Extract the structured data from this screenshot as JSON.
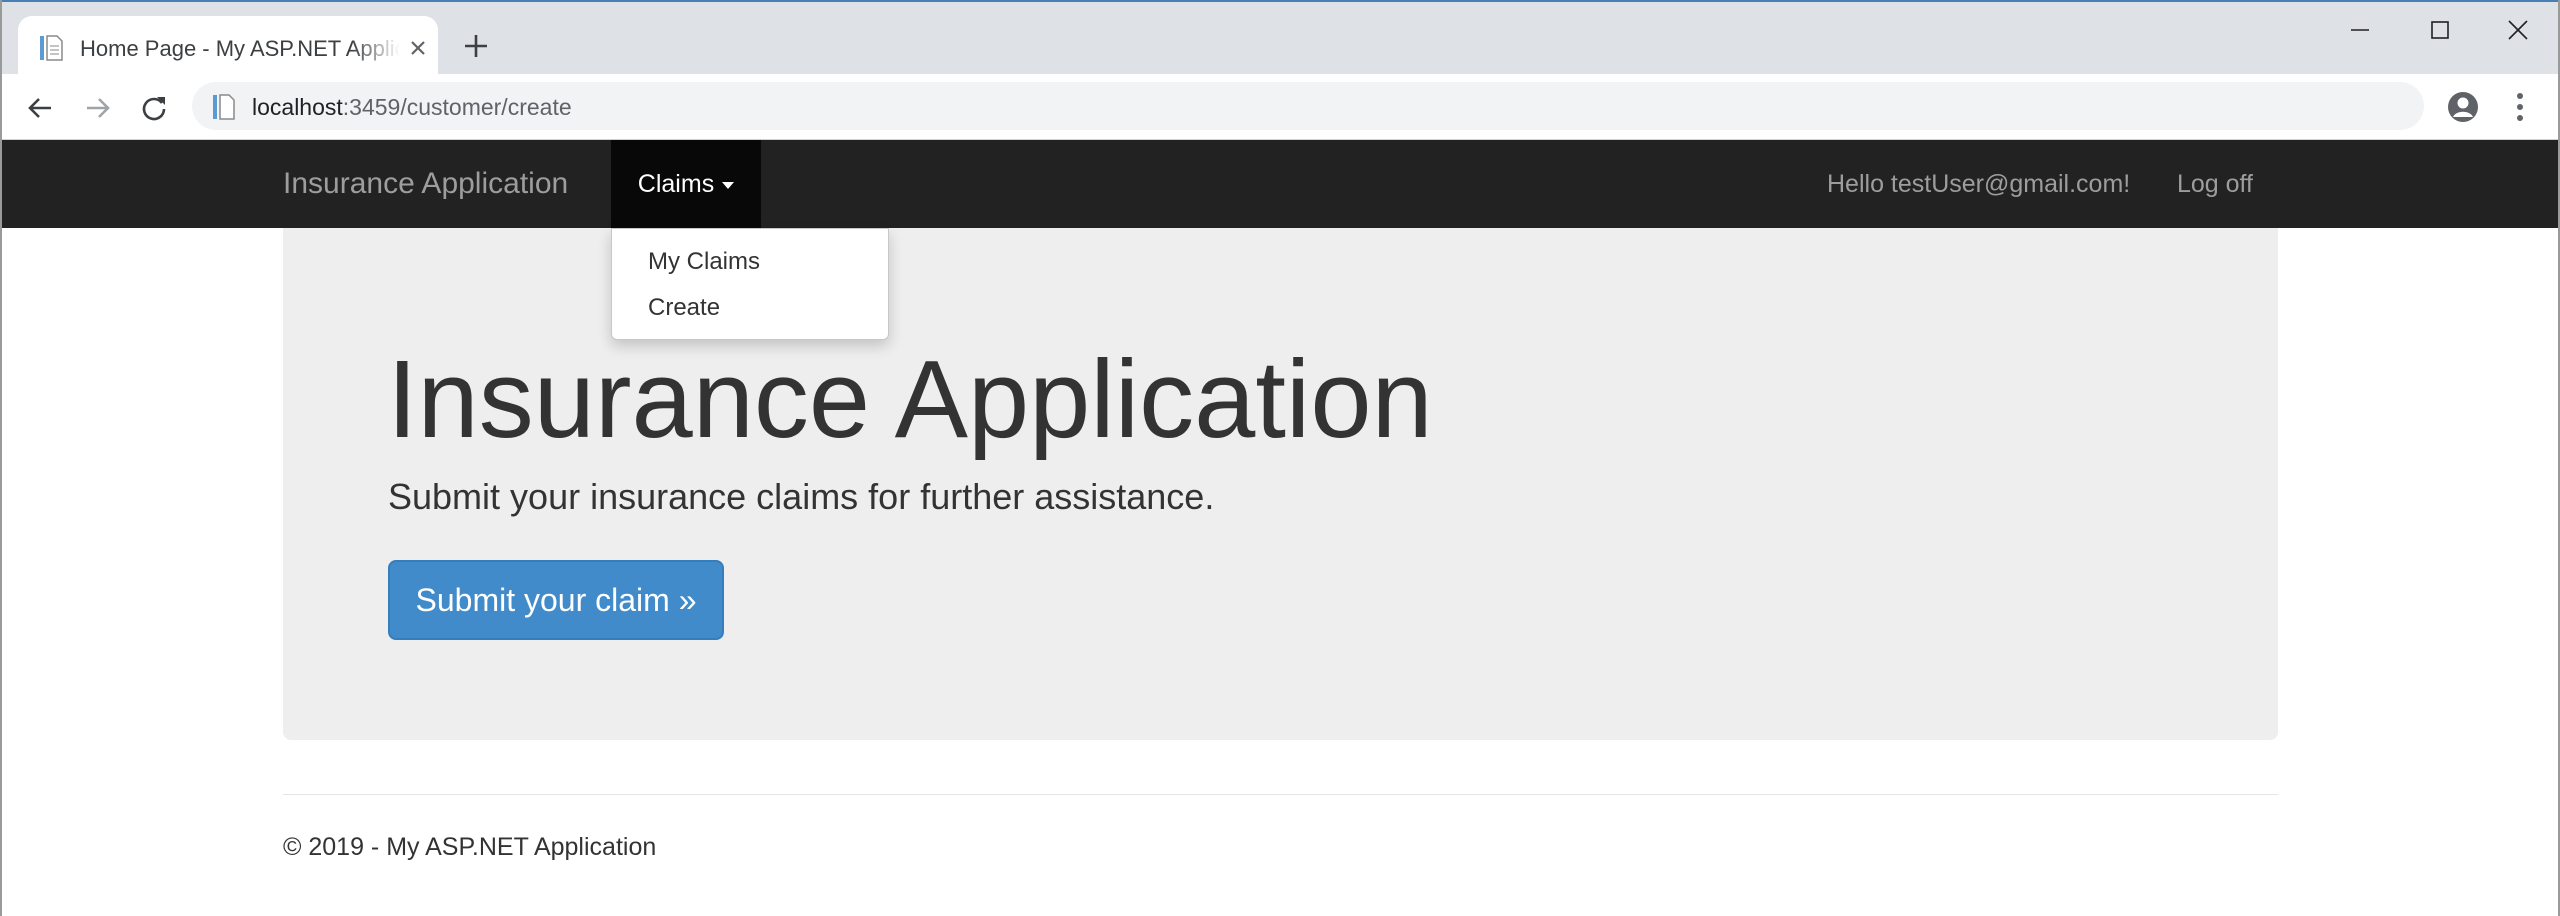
{
  "browser": {
    "tab_title": "Home Page - My ASP.NET Application",
    "url_host": "localhost",
    "url_path": ":3459/customer/create"
  },
  "icons": {
    "favicon": "page-icon",
    "tab_close": "close-icon",
    "new_tab": "plus-icon",
    "back": "arrow-left-icon",
    "forward": "arrow-right-icon",
    "reload": "reload-icon",
    "passwords": "key-icon",
    "profile": "account-circle-icon",
    "menu": "more-vertical-icon"
  },
  "navbar": {
    "brand": "Insurance Application",
    "claims_label": "Claims",
    "greeting": "Hello testUser@gmail.com!",
    "logoff": "Log off"
  },
  "dropdown": {
    "items": [
      {
        "label": "My Claims"
      },
      {
        "label": "Create"
      }
    ]
  },
  "jumbotron": {
    "title": "Insurance Application",
    "lead": "Submit your insurance claims for further assistance.",
    "button_label": "Submit your claim »"
  },
  "footer": {
    "text": "© 2019 - My ASP.NET Application"
  },
  "colors": {
    "navbar_bg": "#222222",
    "navbar_active": "#080808",
    "navbar_text": "#9d9d9d",
    "jumbotron_bg": "#eeeeee",
    "primary_button": "#428bca",
    "chrome_tabstrip": "#dee1e6",
    "omnibox_bg": "#f1f3f4"
  }
}
